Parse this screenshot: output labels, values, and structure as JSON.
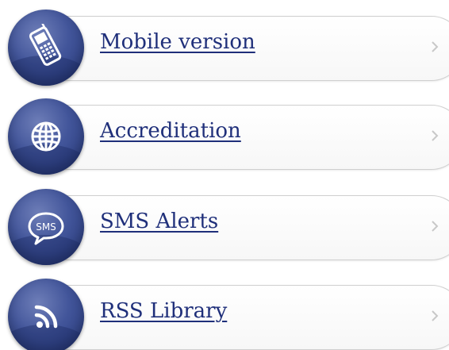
{
  "menu": {
    "items": [
      {
        "label": "Mobile version",
        "icon": "mobile-phone-icon"
      },
      {
        "label": "Accreditation",
        "icon": "globe-icon"
      },
      {
        "label": "SMS Alerts",
        "icon": "sms-bubble-icon"
      },
      {
        "label": "RSS Library",
        "icon": "rss-icon"
      }
    ]
  },
  "colors": {
    "icon_circle": "#3b4f93",
    "link_text": "#1f2f7a",
    "pill_border": "#cfcfcf",
    "chevron": "#c8c8c8"
  }
}
